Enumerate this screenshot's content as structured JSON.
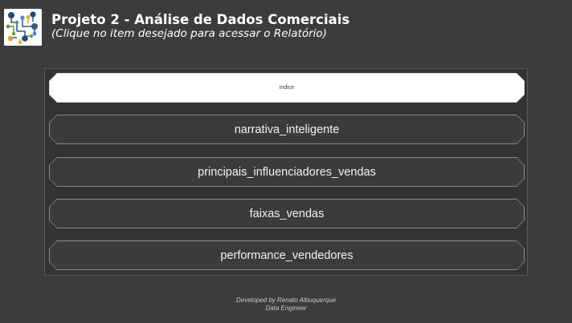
{
  "header": {
    "title": "Projeto 2 - Análise de Dados Comerciais",
    "subtitle": "(Clique no item desejado para acessar o Relatório)",
    "logo_icon": "circuit-logo-icon"
  },
  "menu": {
    "items": [
      {
        "label": "indice",
        "active": true
      },
      {
        "label": "narrativa_inteligente",
        "active": false
      },
      {
        "label": "principais_influenciadores_vendas",
        "active": false
      },
      {
        "label": "faixas_vendas",
        "active": false
      },
      {
        "label": "performance_vendedores",
        "active": false
      }
    ]
  },
  "footer": {
    "line1": "Developed by Renato Albuquerque",
    "line2": "Data Engineer"
  },
  "colors": {
    "background": "#3c3c3c",
    "panel": "#333333",
    "button_border": "#8a8a8a",
    "active_button": "#ffffff"
  }
}
